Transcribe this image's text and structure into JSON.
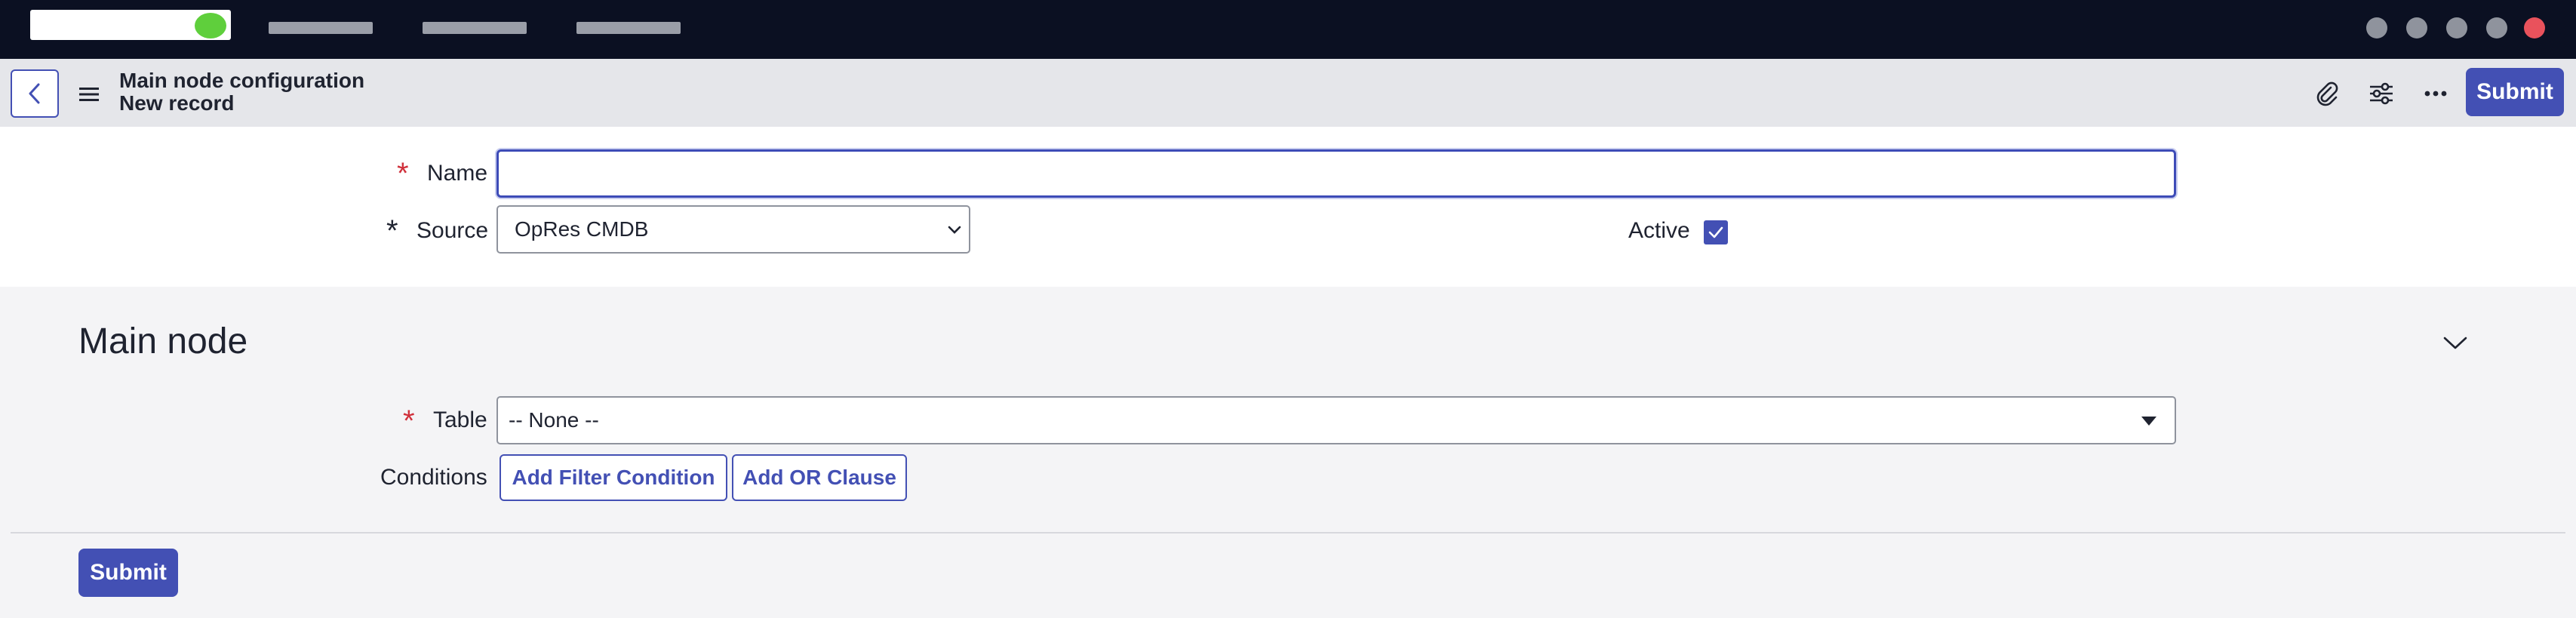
{
  "header": {
    "title": "Main node configuration",
    "subtitle": "New record",
    "submit_label": "Submit"
  },
  "form": {
    "name_label": "Name",
    "name_value": "",
    "source_label": "Source",
    "source_value": "OpRes CMDB",
    "active_label": "Active",
    "active_checked": true
  },
  "main_node": {
    "title": "Main node",
    "table_label": "Table",
    "table_value": "-- None --",
    "conditions_label": "Conditions",
    "add_filter_label": "Add Filter Condition",
    "add_or_label": "Add OR Clause"
  },
  "footer": {
    "submit_label": "Submit"
  },
  "icons": {
    "back": "chevron-left-icon",
    "menu": "hamburger-menu-icon",
    "attachment": "paperclip-icon",
    "personalize": "sliders-icon",
    "more": "more-options-icon",
    "collapse": "chevron-down-icon",
    "checkbox": "checkmark-icon"
  },
  "colors": {
    "primary": "#4350b4",
    "required": "#d0303b",
    "nav_bg": "#0b1022",
    "header_bg": "#e5e6ea",
    "section_bg": "#f4f4f6"
  }
}
